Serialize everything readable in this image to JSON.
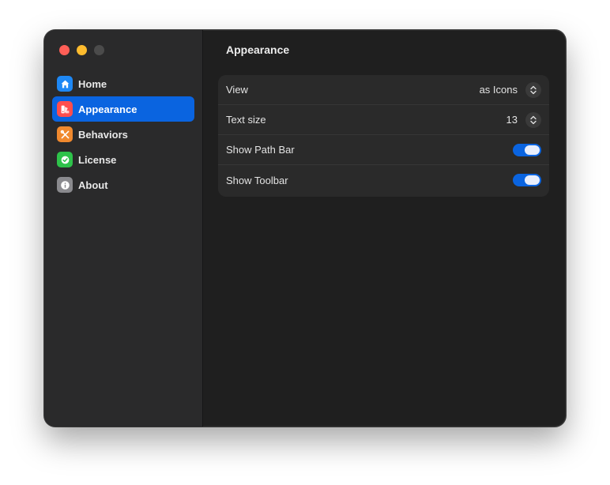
{
  "window": {
    "title": "Appearance"
  },
  "sidebar": {
    "items": [
      {
        "label": "Home",
        "icon": "house-icon",
        "color": "#1e88f5",
        "active": false
      },
      {
        "label": "Appearance",
        "icon": "palette-icon",
        "color": "#ff4d4d",
        "active": true
      },
      {
        "label": "Behaviors",
        "icon": "tools-icon",
        "color": "#f0892e",
        "active": false
      },
      {
        "label": "License",
        "icon": "checkmark-seal-icon",
        "color": "#2ec24a",
        "active": false
      },
      {
        "label": "About",
        "icon": "info-icon",
        "color": "#8a8a8e",
        "active": false
      }
    ]
  },
  "settings": {
    "view": {
      "label": "View",
      "value": "as Icons"
    },
    "text_size": {
      "label": "Text size",
      "value": "13"
    },
    "show_path_bar": {
      "label": "Show Path Bar",
      "on": true
    },
    "show_toolbar": {
      "label": "Show Toolbar",
      "on": true
    }
  },
  "colors": {
    "accent": "#0a64e0",
    "window_bg": "#1f1f1f",
    "sidebar_bg": "#2a2a2b"
  }
}
